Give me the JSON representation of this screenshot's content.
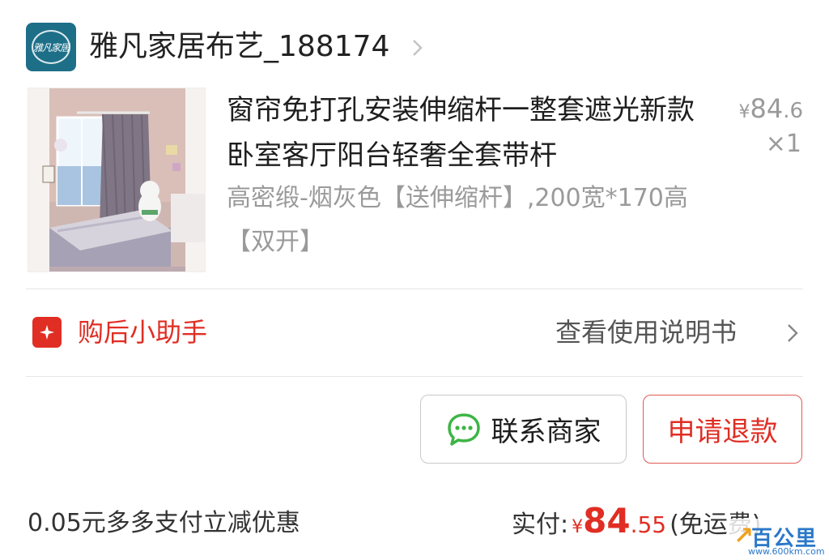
{
  "store": {
    "logo_text": "雅凡家居",
    "name": "雅凡家居布艺_188174"
  },
  "product": {
    "title": "窗帘免打孔安装伸缩杆一整套遮光新款卧室客厅阳台轻奢全套带杆",
    "spec": "高密缎-烟灰色【送伸缩杆】,200宽*170高【双开】",
    "price_currency": "¥",
    "price_integer": "84",
    "price_decimal": ".6",
    "quantity": "×1"
  },
  "helper": {
    "label": "购后小助手",
    "manual_link": "查看使用说明书"
  },
  "actions": {
    "contact_label": "联系商家",
    "refund_label": "申请退款"
  },
  "footer": {
    "discount_text": "0.05元多多支付立减优惠",
    "paid_label": "实付:",
    "paid_currency": "¥",
    "paid_integer": "84",
    "paid_decimal": ".55",
    "shipping_note": "(免运费)"
  },
  "watermark": {
    "text": "百公里",
    "url": "www.600km.com"
  },
  "colors": {
    "accent_red": "#e02e24",
    "chat_green": "#3cb544",
    "logo_blue": "#1d6f88"
  }
}
